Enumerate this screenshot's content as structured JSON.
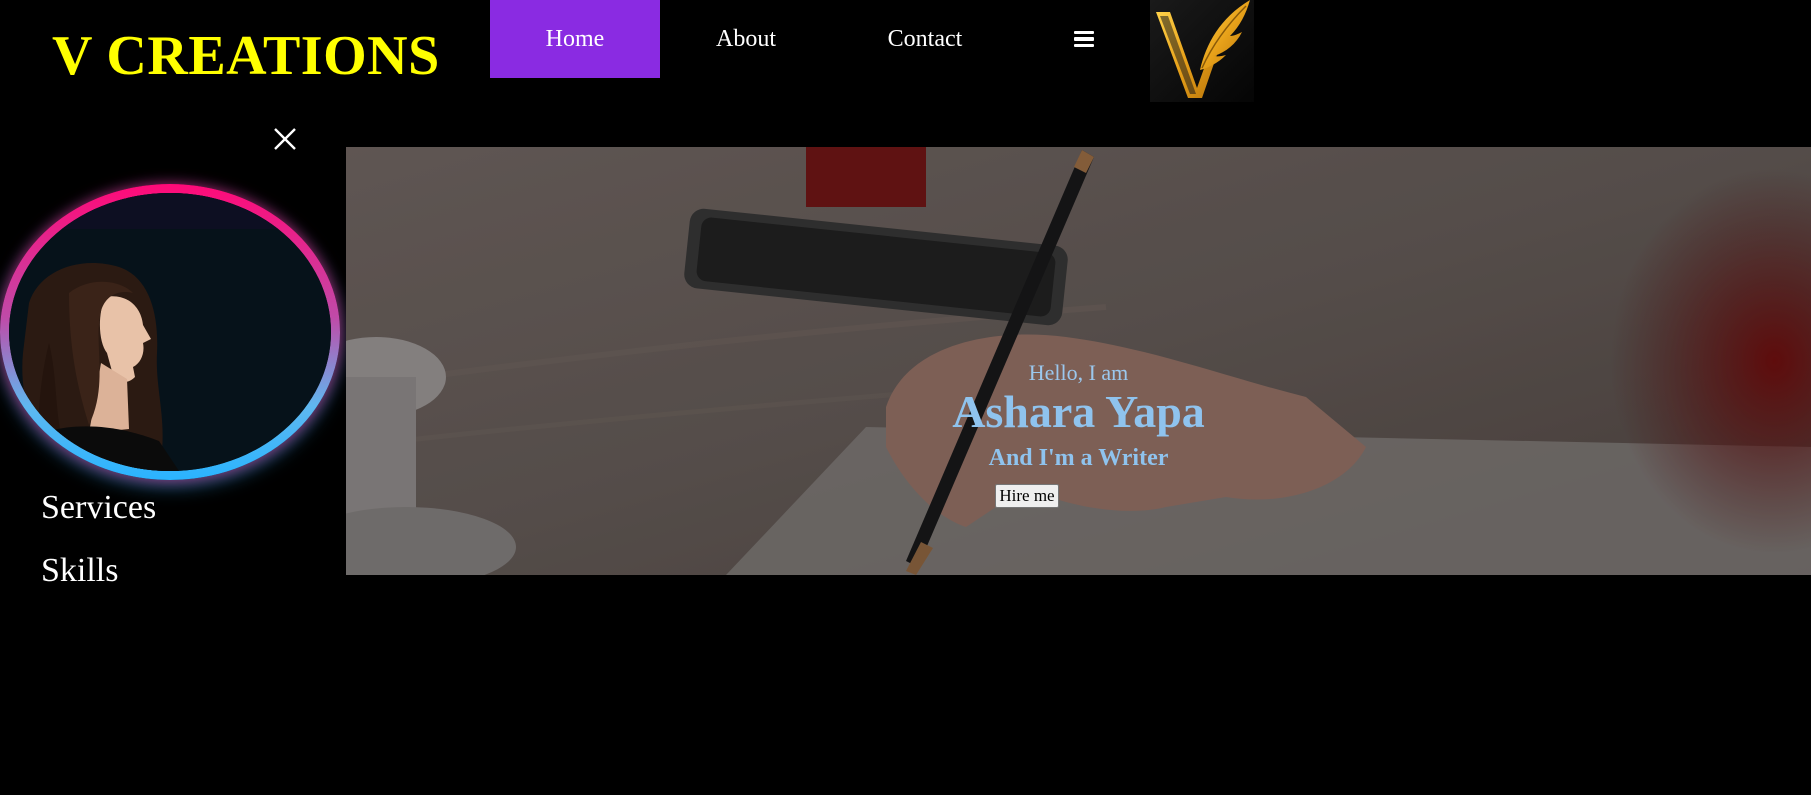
{
  "header": {
    "brand": "V CREATIONS",
    "nav": {
      "home": "Home",
      "about": "About",
      "contact": "Contact"
    },
    "menu_icon": "hamburger-icon",
    "logo_icon": "v-feather-logo"
  },
  "sidebar": {
    "close_icon": "close-icon",
    "links": {
      "services": "Services",
      "skills": "Skills"
    }
  },
  "hero": {
    "greeting": "Hello, I am",
    "name": "Ashara Yapa",
    "role": "And I'm a Writer",
    "cta": "Hire me"
  },
  "colors": {
    "background": "#000000",
    "brand": "#ffff00",
    "nav_active": "#8a2be2",
    "hero_text": "#8fc3ee",
    "ring_top": "#ff0a78",
    "ring_bottom": "#2ab4ff"
  }
}
